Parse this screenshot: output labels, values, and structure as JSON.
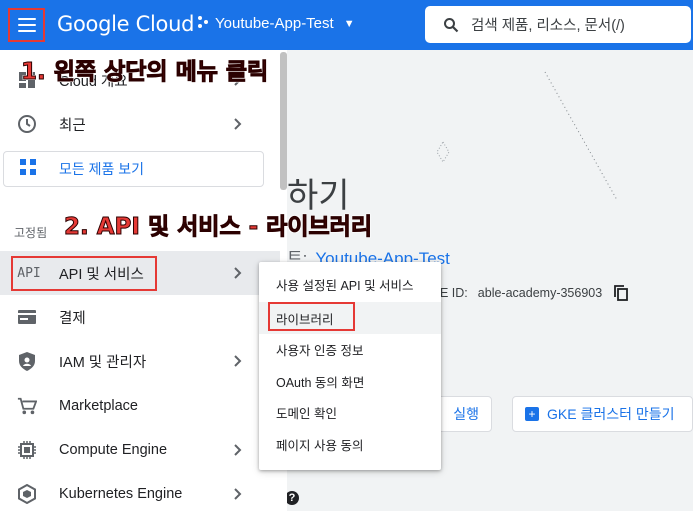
{
  "header": {
    "logo": "Google Cloud",
    "project_name": "Youtube-App-Test",
    "search_placeholder": "검색   제품, 리소스, 문서(/)"
  },
  "annotations": {
    "step1": "1. 왼쪽 상단의 메뉴 클릭",
    "step2": "2. API 및 서비스 - 라이브러리"
  },
  "sidenav": {
    "items": [
      {
        "label": "Cloud 개요",
        "icon": "dashboard-icon"
      },
      {
        "label": "최근",
        "icon": "clock-icon"
      },
      {
        "label": "모든 제품 보기",
        "icon": "grid-icon"
      }
    ],
    "pinned_label": "고정됨",
    "pinned": [
      {
        "label": "API 및 서비스",
        "icon": "api-icon"
      },
      {
        "label": "결제",
        "icon": "billing-icon"
      },
      {
        "label": "IAM 및 관리자",
        "icon": "shield-icon"
      },
      {
        "label": "Marketplace",
        "icon": "cart-icon"
      },
      {
        "label": "Compute Engine",
        "icon": "chip-icon"
      },
      {
        "label": "Kubernetes Engine",
        "icon": "hexagon-icon"
      }
    ]
  },
  "submenu": {
    "items": [
      "사용 설정된 API 및 서비스",
      "라이브러리",
      "사용자 인증 정보",
      "OAuth 동의 화면",
      "도메인 확인",
      "페이지 사용 동의"
    ]
  },
  "main": {
    "title_fragment": "하기",
    "project_label": "트:",
    "project_value": "Youtube-App-Test",
    "id_label": "E ID:",
    "id_value": "able-academy-356903",
    "run_button": "실행",
    "gke_button": "GKE 클러스터 만들기",
    "help_glyph": "?"
  }
}
